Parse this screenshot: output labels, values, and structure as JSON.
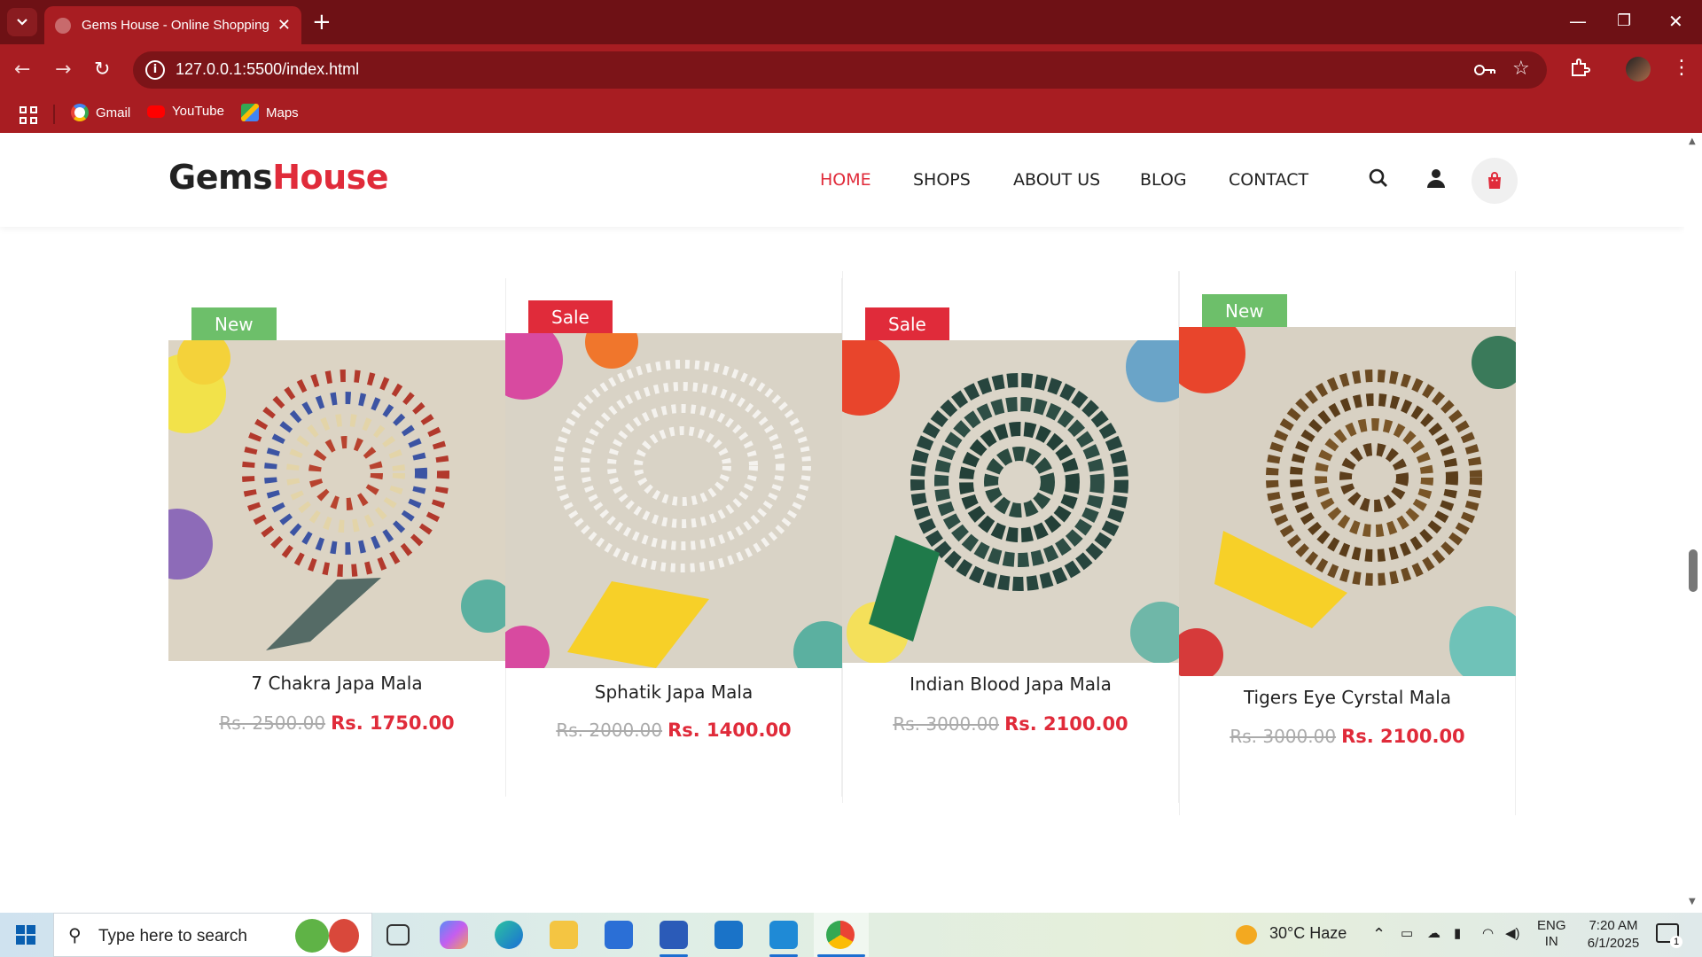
{
  "browser": {
    "tab_title": "Gems House - Online Shopping",
    "url": "127.0.0.1:5500/index.html",
    "bookmarks": [
      "Gmail",
      "YouTube",
      "Maps"
    ]
  },
  "site": {
    "logo_part1": "Gems",
    "logo_part2": "House",
    "nav": [
      "HOME",
      "SHOPS",
      "ABOUT US",
      "BLOG",
      "CONTACT"
    ],
    "active_nav": "HOME"
  },
  "products": [
    {
      "badge": "New",
      "name": "7 Chakra Japa Mala",
      "old_price": "Rs. 2500.00",
      "price": "Rs. 1750.00"
    },
    {
      "badge": "Sale",
      "name": "Sphatik Japa Mala",
      "old_price": "Rs. 2000.00",
      "price": "Rs. 1400.00"
    },
    {
      "badge": "Sale",
      "name": "Indian Blood Japa Mala",
      "old_price": "Rs. 3000.00",
      "price": "Rs. 2100.00"
    },
    {
      "badge": "New",
      "name": "Tigers Eye Cyrstal Mala",
      "old_price": "Rs. 3000.00",
      "price": "Rs. 2100.00"
    }
  ],
  "taskbar": {
    "search_placeholder": "Type here to search",
    "weather": "30°C  Haze",
    "lang1": "ENG",
    "lang2": "IN",
    "time": "7:20 AM",
    "date": "6/1/2025",
    "notification_count": "1"
  },
  "colors": {
    "brand_red": "#e02b3a",
    "new_badge": "#6dbf6a",
    "chrome_red": "#a81d22"
  }
}
